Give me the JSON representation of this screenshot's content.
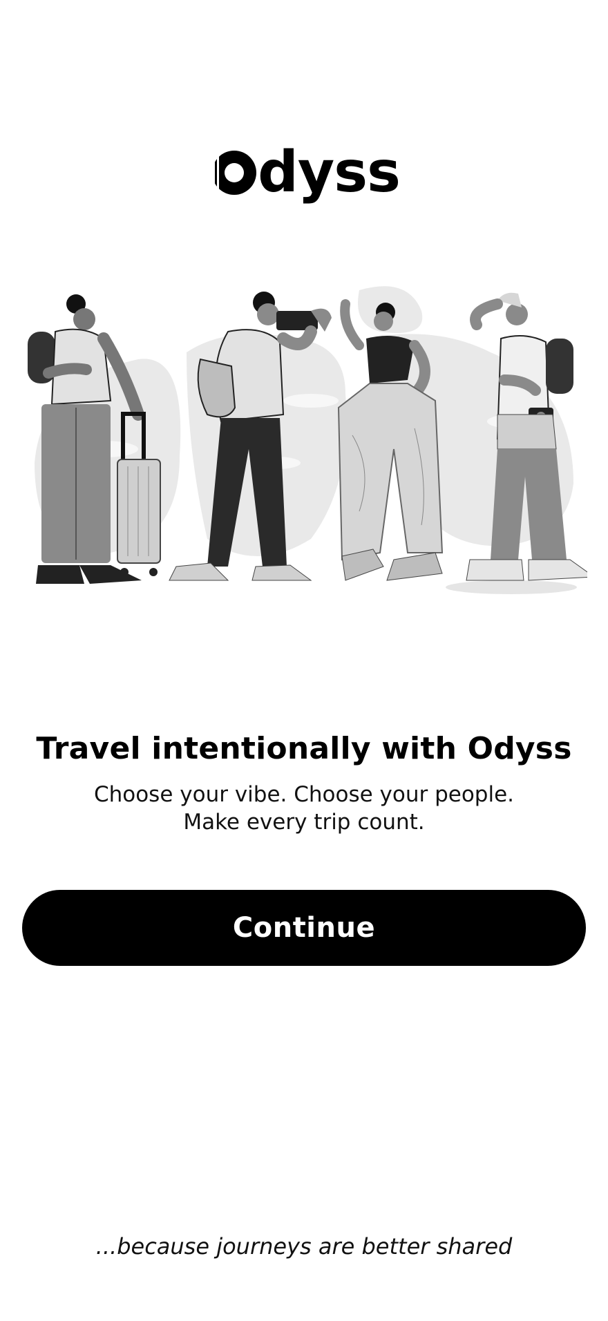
{
  "app": {
    "logo_text": "dyss"
  },
  "hero": {
    "headline_prefix": "Travel intentionally with ",
    "headline_brand": "Odyss",
    "subtitle_line1": "Choose your vibe. Choose your people.",
    "subtitle_line2": "Make every trip count."
  },
  "actions": {
    "continue_label": "Continue"
  },
  "footer": {
    "tagline": "...because journeys are better shared"
  },
  "illustration": {
    "icon": "travelers-illustration"
  },
  "colors": {
    "primary": "#000000",
    "background": "#ffffff",
    "button_text": "#ffffff"
  }
}
